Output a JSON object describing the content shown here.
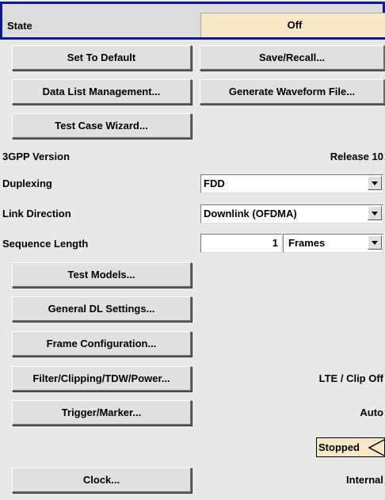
{
  "state": {
    "label": "State",
    "value": "Off"
  },
  "buttons": {
    "set_to_default": "Set To Default",
    "save_recall": "Save/Recall...",
    "data_list_management": "Data List Management...",
    "generate_waveform_file": "Generate Waveform File...",
    "test_case_wizard": "Test Case Wizard...",
    "test_models": "Test Models...",
    "general_dl_settings": "General DL Settings...",
    "frame_configuration": "Frame Configuration...",
    "filter_clipping": "Filter/Clipping/TDW/Power...",
    "trigger_marker": "Trigger/Marker...",
    "clock": "Clock..."
  },
  "gpp_version": {
    "label": "3GPP Version",
    "value": "Release 10"
  },
  "duplexing": {
    "label": "Duplexing",
    "value": "FDD"
  },
  "link_direction": {
    "label": "Link Direction",
    "value": "Downlink (OFDMA)"
  },
  "sequence_length": {
    "label": "Sequence Length",
    "value": "1",
    "unit": "Frames"
  },
  "filter_status": "LTE / Clip Off",
  "trigger_status": "Auto",
  "run_status": "Stopped",
  "clock_status": "Internal",
  "colors": {
    "state_bg": "#f9e8c8",
    "border_blue": "#0b1a8c",
    "status_bg": "#f9e8c8"
  }
}
